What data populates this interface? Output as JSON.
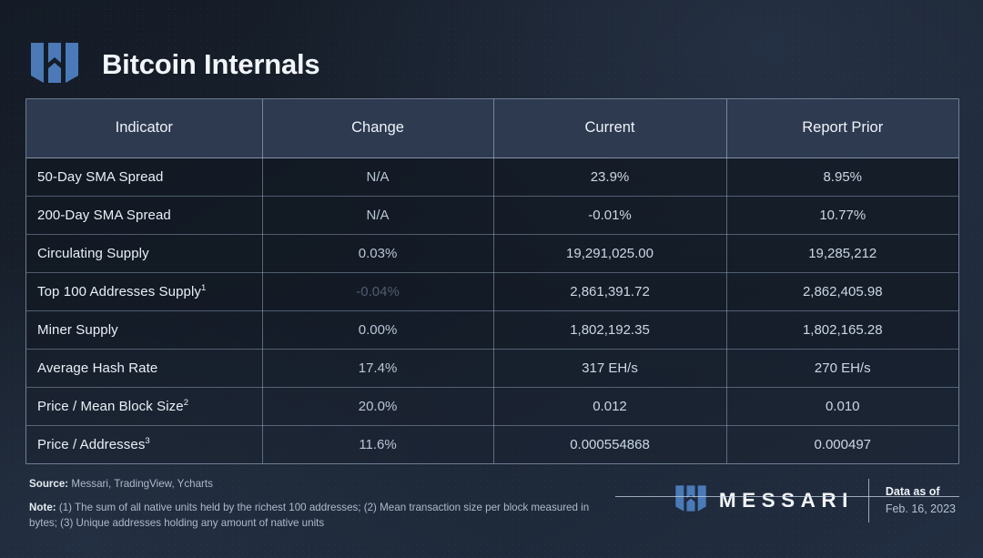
{
  "header": {
    "title": "Bitcoin Internals",
    "logo_icon": "messari-m-logo-icon"
  },
  "table": {
    "columns": [
      "Indicator",
      "Change",
      "Current",
      "Report Prior"
    ],
    "rows": [
      {
        "indicator": "50-Day SMA Spread",
        "indicator_sup": "",
        "change": "N/A",
        "change_faint": false,
        "current": "23.9%",
        "prior": "8.95%"
      },
      {
        "indicator": "200-Day SMA Spread",
        "indicator_sup": "",
        "change": "N/A",
        "change_faint": false,
        "current": "-0.01%",
        "prior": "10.77%"
      },
      {
        "indicator": "Circulating Supply",
        "indicator_sup": "",
        "change": "0.03%",
        "change_faint": false,
        "current": "19,291,025.00",
        "prior": "19,285,212"
      },
      {
        "indicator": "Top 100 Addresses Supply",
        "indicator_sup": "1",
        "change": "-0.04%",
        "change_faint": true,
        "current": "2,861,391.72",
        "prior": "2,862,405.98"
      },
      {
        "indicator": "Miner Supply",
        "indicator_sup": "",
        "change": "0.00%",
        "change_faint": false,
        "current": "1,802,192.35",
        "prior": "1,802,165.28"
      },
      {
        "indicator": "Average Hash Rate",
        "indicator_sup": "",
        "change": "17.4%",
        "change_faint": false,
        "current": "317 EH/s",
        "prior": "270 EH/s"
      },
      {
        "indicator": "Price / Mean Block Size",
        "indicator_sup": "2",
        "change": "20.0%",
        "change_faint": false,
        "current": "0.012",
        "prior": "0.010"
      },
      {
        "indicator": "Price / Addresses",
        "indicator_sup": "3",
        "change": "11.6%",
        "change_faint": false,
        "current": "0.000554868",
        "prior": "0.000497"
      }
    ]
  },
  "footer": {
    "source_label": "Source:",
    "source_text": "Messari, TradingView, Ycharts",
    "note_label": "Note:",
    "note_text": "(1) The sum of all native units held by the richest 100 addresses; (2) Mean transaction size per block measured in bytes; (3) Unique addresses holding any amount of native units",
    "brand_name": "MESSARI",
    "brand_logo_icon": "messari-m-logo-icon",
    "date_label": "Data as of",
    "date_value": "Feb. 16, 2023"
  },
  "colors": {
    "brand_blue": "#4a7ab8",
    "header_row_bg": "#2e3a50",
    "page_bg_dark": "#141b26",
    "page_bg_light": "#222e41",
    "border": "#b0c4de"
  }
}
